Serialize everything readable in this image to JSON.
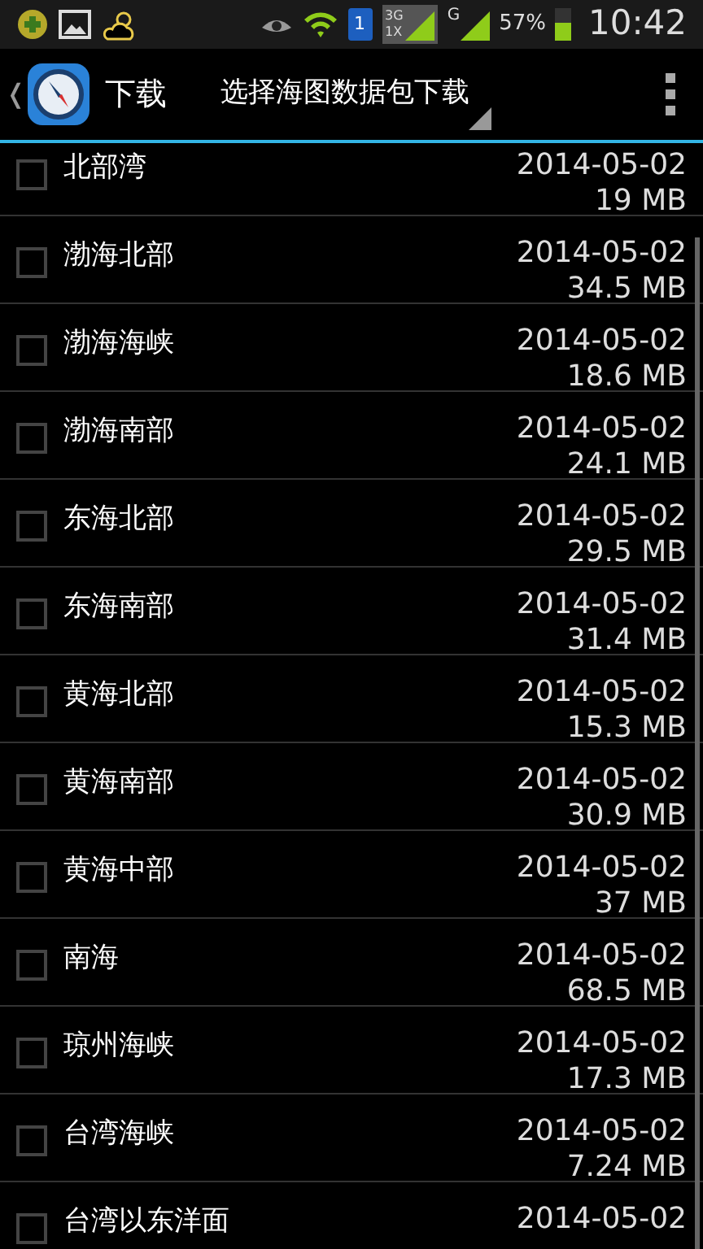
{
  "status_bar": {
    "sim_slot": "1",
    "network_3g": "3G",
    "network_1x": "1X",
    "network_g": "G",
    "battery": "57%",
    "time": "10:42"
  },
  "action_bar": {
    "back": "❬",
    "title": "下载",
    "subtitle": "选择海图数据包下载"
  },
  "list": [
    {
      "name": "北部湾",
      "date": "2014-05-02",
      "size": "19 MB",
      "checked": false
    },
    {
      "name": "渤海北部",
      "date": "2014-05-02",
      "size": "34.5 MB",
      "checked": false
    },
    {
      "name": "渤海海峡",
      "date": "2014-05-02",
      "size": "18.6 MB",
      "checked": false
    },
    {
      "name": "渤海南部",
      "date": "2014-05-02",
      "size": "24.1 MB",
      "checked": false
    },
    {
      "name": "东海北部",
      "date": "2014-05-02",
      "size": "29.5 MB",
      "checked": false
    },
    {
      "name": "东海南部",
      "date": "2014-05-02",
      "size": "31.4 MB",
      "checked": false
    },
    {
      "name": "黄海北部",
      "date": "2014-05-02",
      "size": "15.3 MB",
      "checked": false
    },
    {
      "name": "黄海南部",
      "date": "2014-05-02",
      "size": "30.9 MB",
      "checked": false
    },
    {
      "name": "黄海中部",
      "date": "2014-05-02",
      "size": "37 MB",
      "checked": false
    },
    {
      "name": "南海",
      "date": "2014-05-02",
      "size": "68.5 MB",
      "checked": false
    },
    {
      "name": "琼州海峡",
      "date": "2014-05-02",
      "size": "17.3 MB",
      "checked": false
    },
    {
      "name": "台湾海峡",
      "date": "2014-05-02",
      "size": "7.24 MB",
      "checked": false
    },
    {
      "name": "台湾以东洋面",
      "date": "2014-05-02",
      "checked": false
    }
  ]
}
